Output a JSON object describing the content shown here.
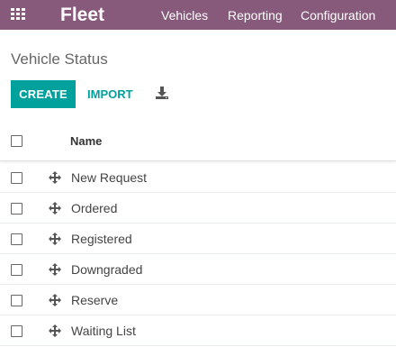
{
  "app": {
    "title": "Fleet"
  },
  "menu": [
    {
      "label": "Vehicles"
    },
    {
      "label": "Reporting"
    },
    {
      "label": "Configuration"
    }
  ],
  "breadcrumb": "Vehicle Status",
  "toolbar": {
    "create_label": "CREATE",
    "import_label": "IMPORT"
  },
  "table": {
    "header": "Name",
    "rows": [
      {
        "label": "New Request"
      },
      {
        "label": "Ordered"
      },
      {
        "label": "Registered"
      },
      {
        "label": "Downgraded"
      },
      {
        "label": "Reserve"
      },
      {
        "label": "Waiting List"
      }
    ]
  },
  "colors": {
    "brand": "#875a7b",
    "accent": "#00a09d"
  }
}
